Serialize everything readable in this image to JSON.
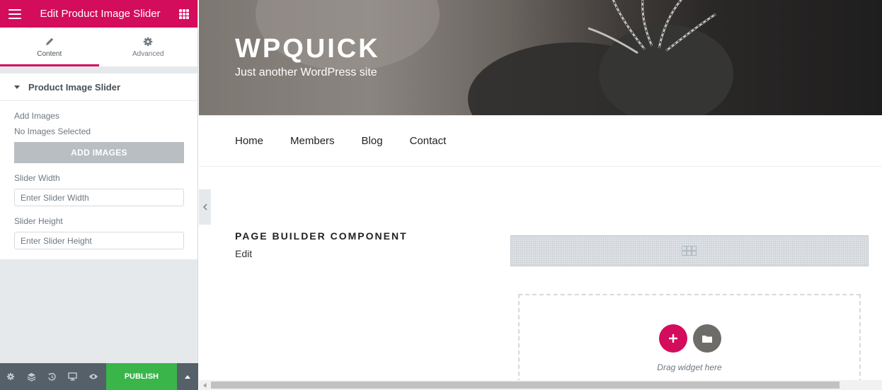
{
  "panel": {
    "title": "Edit Product Image Slider",
    "tabs": [
      {
        "label": "Content",
        "icon": "pencil-icon"
      },
      {
        "label": "Advanced",
        "icon": "gear-icon"
      }
    ],
    "section_title": "Product Image Slider",
    "controls": {
      "add_images_label": "Add Images",
      "no_images_text": "No Images Selected",
      "add_images_button": "ADD IMAGES",
      "slider_width_label": "Slider Width",
      "slider_width_placeholder": "Enter Slider Width",
      "slider_height_label": "Slider Height",
      "slider_height_placeholder": "Enter Slider Height"
    },
    "footer": {
      "icons": [
        "gear-icon",
        "layers-icon",
        "history-icon",
        "desktop-icon",
        "eye-icon"
      ],
      "publish_label": "PUBLISH"
    },
    "accent": "#d30c5c"
  },
  "site": {
    "title": "WPQUICK",
    "tagline": "Just another WordPress site",
    "nav": [
      "Home",
      "Members",
      "Blog",
      "Contact"
    ]
  },
  "content": {
    "component_title": "PAGE BUILDER COMPONENT",
    "edit_text": "Edit",
    "drag_text": "Drag widget here"
  }
}
